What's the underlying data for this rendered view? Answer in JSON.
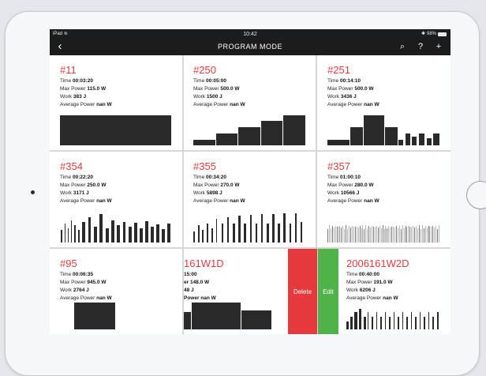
{
  "status": {
    "device": "iPad",
    "wifi_icon": "wifi-icon",
    "time": "10:42",
    "battery": "98%"
  },
  "nav": {
    "back_icon": "chevron-left-icon",
    "title": "PROGRAM MODE",
    "search": "search-icon",
    "help": "?",
    "add": "+"
  },
  "labels": {
    "time": "Time",
    "max_power": "Max Power",
    "work": "Work",
    "avg_power": "Average Power"
  },
  "actions": {
    "delete": "Delete",
    "edit": "Edit"
  },
  "colors": {
    "accent": "#e23b3e",
    "delete": "#e5393d",
    "edit": "#4fb34a",
    "bar": "#2a2a2a"
  },
  "programs": [
    {
      "id": "#11",
      "time": "00:03:20",
      "max_power": "115.0 W",
      "work": "383 J",
      "avg_power": "nan W",
      "bars": [
        {
          "x": 0,
          "w": 1,
          "h": 0.95
        }
      ]
    },
    {
      "id": "#250",
      "time": "00:05:00",
      "max_power": "500.0 W",
      "work": "1500 J",
      "avg_power": "nan W",
      "bars": [
        {
          "x": 0,
          "w": 0.2,
          "h": 0.18
        },
        {
          "x": 0.2,
          "w": 0.2,
          "h": 0.38
        },
        {
          "x": 0.4,
          "w": 0.2,
          "h": 0.58
        },
        {
          "x": 0.6,
          "w": 0.2,
          "h": 0.77
        },
        {
          "x": 0.8,
          "w": 0.2,
          "h": 0.95
        }
      ]
    },
    {
      "id": "#251",
      "time": "00:14:10",
      "max_power": "500.0 W",
      "work": "3436 J",
      "avg_power": "nan W",
      "bars": [
        {
          "x": 0,
          "w": 0.2,
          "h": 0.18
        },
        {
          "x": 0.2,
          "w": 0.12,
          "h": 0.58
        },
        {
          "x": 0.32,
          "w": 0.19,
          "h": 0.95
        },
        {
          "x": 0.51,
          "w": 0.12,
          "h": 0.58
        },
        {
          "x": 0.63,
          "w": 0.05,
          "h": 0.18
        },
        {
          "x": 0.69,
          "w": 0.05,
          "h": 0.38
        },
        {
          "x": 0.75,
          "w": 0.05,
          "h": 0.28
        },
        {
          "x": 0.81,
          "w": 0.06,
          "h": 0.38
        },
        {
          "x": 0.88,
          "w": 0.05,
          "h": 0.22
        },
        {
          "x": 0.94,
          "w": 0.06,
          "h": 0.38
        }
      ]
    },
    {
      "id": "#354",
      "time": "00:22:20",
      "max_power": "250.0 W",
      "work": "3171 J",
      "avg_power": "nan W",
      "bars": [
        {
          "x": 0.01,
          "w": 0.015,
          "h": 0.4
        },
        {
          "x": 0.04,
          "w": 0.015,
          "h": 0.6
        },
        {
          "x": 0.07,
          "w": 0.015,
          "h": 0.45
        },
        {
          "x": 0.1,
          "w": 0.015,
          "h": 0.7
        },
        {
          "x": 0.13,
          "w": 0.02,
          "h": 0.55
        },
        {
          "x": 0.16,
          "w": 0.02,
          "h": 0.4
        },
        {
          "x": 0.2,
          "w": 0.03,
          "h": 0.65
        },
        {
          "x": 0.25,
          "w": 0.03,
          "h": 0.8
        },
        {
          "x": 0.3,
          "w": 0.035,
          "h": 0.5
        },
        {
          "x": 0.35,
          "w": 0.04,
          "h": 0.9
        },
        {
          "x": 0.41,
          "w": 0.035,
          "h": 0.45
        },
        {
          "x": 0.46,
          "w": 0.035,
          "h": 0.7
        },
        {
          "x": 0.51,
          "w": 0.035,
          "h": 0.55
        },
        {
          "x": 0.56,
          "w": 0.035,
          "h": 0.65
        },
        {
          "x": 0.61,
          "w": 0.035,
          "h": 0.5
        },
        {
          "x": 0.66,
          "w": 0.035,
          "h": 0.62
        },
        {
          "x": 0.71,
          "w": 0.035,
          "h": 0.45
        },
        {
          "x": 0.76,
          "w": 0.035,
          "h": 0.68
        },
        {
          "x": 0.81,
          "w": 0.035,
          "h": 0.5
        },
        {
          "x": 0.86,
          "w": 0.035,
          "h": 0.58
        },
        {
          "x": 0.91,
          "w": 0.035,
          "h": 0.42
        },
        {
          "x": 0.96,
          "w": 0.035,
          "h": 0.6
        }
      ]
    },
    {
      "id": "#355",
      "time": "00:34:20",
      "max_power": "270.0 W",
      "work": "5898 J",
      "avg_power": "nan W",
      "bars": [
        {
          "x": 0.0,
          "w": 0.02,
          "h": 0.35
        },
        {
          "x": 0.04,
          "w": 0.02,
          "h": 0.55
        },
        {
          "x": 0.08,
          "w": 0.02,
          "h": 0.4
        },
        {
          "x": 0.12,
          "w": 0.02,
          "h": 0.6
        },
        {
          "x": 0.16,
          "w": 0.02,
          "h": 0.45
        },
        {
          "x": 0.2,
          "w": 0.02,
          "h": 0.75
        },
        {
          "x": 0.25,
          "w": 0.025,
          "h": 0.6
        },
        {
          "x": 0.3,
          "w": 0.025,
          "h": 0.8
        },
        {
          "x": 0.35,
          "w": 0.025,
          "h": 0.6
        },
        {
          "x": 0.4,
          "w": 0.025,
          "h": 0.85
        },
        {
          "x": 0.45,
          "w": 0.025,
          "h": 0.6
        },
        {
          "x": 0.5,
          "w": 0.025,
          "h": 0.88
        },
        {
          "x": 0.55,
          "w": 0.025,
          "h": 0.6
        },
        {
          "x": 0.6,
          "w": 0.025,
          "h": 0.9
        },
        {
          "x": 0.65,
          "w": 0.025,
          "h": 0.6
        },
        {
          "x": 0.7,
          "w": 0.025,
          "h": 0.9
        },
        {
          "x": 0.75,
          "w": 0.025,
          "h": 0.6
        },
        {
          "x": 0.8,
          "w": 0.025,
          "h": 0.92
        },
        {
          "x": 0.85,
          "w": 0.025,
          "h": 0.6
        },
        {
          "x": 0.9,
          "w": 0.025,
          "h": 0.92
        },
        {
          "x": 0.95,
          "w": 0.025,
          "h": 0.65
        }
      ]
    },
    {
      "id": "#357",
      "time": "01:00:10",
      "max_power": "280.0 W",
      "work": "10566 J",
      "avg_power": "nan W",
      "striped": true,
      "bars": []
    },
    {
      "id": "#95",
      "time": "00:06:35",
      "max_power": "945.0 W",
      "work": "2764 J",
      "avg_power": "nan W",
      "bars": [
        {
          "x": 0.13,
          "w": 0.37,
          "h": 0.85
        }
      ]
    },
    {
      "id": "161W1D",
      "time": "15:00",
      "max_power": "er 148.0 W",
      "work": "48 J",
      "avg_power": "Power nan W",
      "bars": [
        {
          "x": 0.0,
          "w": 0.08,
          "h": 0.55
        },
        {
          "x": 0.08,
          "w": 0.52,
          "h": 0.85
        },
        {
          "x": 0.6,
          "w": 0.32,
          "h": 0.6
        }
      ]
    },
    {
      "id": "2006161W2D",
      "time": "00:40:00",
      "max_power": "191.0 W",
      "work": "6206 J",
      "avg_power": "nan W",
      "bars": [
        {
          "x": 0.0,
          "w": 0.03,
          "h": 0.25
        },
        {
          "x": 0.04,
          "w": 0.03,
          "h": 0.4
        },
        {
          "x": 0.08,
          "w": 0.04,
          "h": 0.55
        },
        {
          "x": 0.13,
          "w": 0.03,
          "h": 0.65
        },
        {
          "x": 0.18,
          "w": 0.03,
          "h": 0.4
        },
        {
          "x": 0.22,
          "w": 0.02,
          "h": 0.55
        },
        {
          "x": 0.26,
          "w": 0.03,
          "h": 0.4
        },
        {
          "x": 0.31,
          "w": 0.02,
          "h": 0.55
        },
        {
          "x": 0.35,
          "w": 0.03,
          "h": 0.4
        },
        {
          "x": 0.4,
          "w": 0.02,
          "h": 0.55
        },
        {
          "x": 0.44,
          "w": 0.03,
          "h": 0.4
        },
        {
          "x": 0.49,
          "w": 0.02,
          "h": 0.55
        },
        {
          "x": 0.53,
          "w": 0.03,
          "h": 0.4
        },
        {
          "x": 0.58,
          "w": 0.02,
          "h": 0.55
        },
        {
          "x": 0.62,
          "w": 0.03,
          "h": 0.4
        },
        {
          "x": 0.67,
          "w": 0.02,
          "h": 0.55
        },
        {
          "x": 0.71,
          "w": 0.03,
          "h": 0.4
        },
        {
          "x": 0.76,
          "w": 0.02,
          "h": 0.55
        },
        {
          "x": 0.8,
          "w": 0.03,
          "h": 0.4
        },
        {
          "x": 0.85,
          "w": 0.02,
          "h": 0.55
        },
        {
          "x": 0.89,
          "w": 0.03,
          "h": 0.4
        },
        {
          "x": 0.94,
          "w": 0.03,
          "h": 0.55
        }
      ]
    }
  ]
}
